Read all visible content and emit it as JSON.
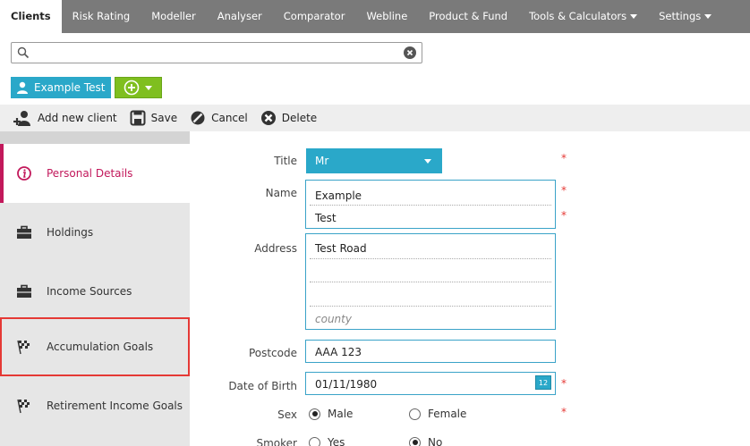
{
  "nav": {
    "tabs": [
      {
        "label": "Clients"
      },
      {
        "label": "Risk Rating"
      },
      {
        "label": "Modeller"
      },
      {
        "label": "Analyser"
      },
      {
        "label": "Comparator"
      },
      {
        "label": "Webline"
      },
      {
        "label": "Product & Fund"
      },
      {
        "label": "Tools & Calculators"
      },
      {
        "label": "Settings"
      }
    ]
  },
  "search": {
    "value": "",
    "placeholder": ""
  },
  "client_chip": {
    "label": "Example Test"
  },
  "toolbar": {
    "add_label": "Add new client",
    "save_label": "Save",
    "cancel_label": "Cancel",
    "delete_label": "Delete"
  },
  "sidebar": {
    "items": [
      {
        "label": "Personal Details"
      },
      {
        "label": "Holdings"
      },
      {
        "label": "Income Sources"
      },
      {
        "label": "Accumulation Goals"
      },
      {
        "label": "Retirement Income Goals"
      }
    ]
  },
  "form": {
    "title_label": "Title",
    "title_value": "Mr",
    "name_label": "Name",
    "first_name": "Example",
    "last_name": "Test",
    "address_label": "Address",
    "address_line1": "Test Road",
    "address_county_placeholder": "county",
    "postcode_label": "Postcode",
    "postcode_value": "AAA 123",
    "dob_label": "Date of Birth",
    "dob_value": "01/11/1980",
    "calendar_day": "12",
    "sex_label": "Sex",
    "sex_male": "Male",
    "sex_female": "Female",
    "smoker_label": "Smoker",
    "smoker_yes": "Yes",
    "smoker_no": "No",
    "required_mark": "*"
  },
  "colors": {
    "accent": "#2aa8c9",
    "add_green": "#7fbf1f",
    "active_pink": "#c2185b",
    "highlight_red": "#e53935",
    "nav_bg": "#7a7a7a"
  }
}
